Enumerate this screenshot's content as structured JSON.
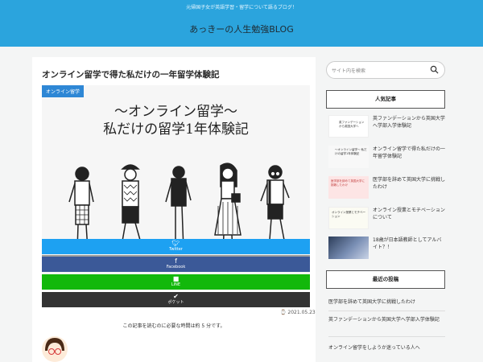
{
  "header": {
    "tagline": "元帰国子女が英語学習・留学について語るブログ！",
    "site_title": "あっきーの人生勉強BLOG"
  },
  "article": {
    "title": "オンライン留学で得た私だけの一年留学体験記",
    "category": "オンライン留学",
    "hero_line1": "〜オンライン留学〜",
    "hero_line2": "私だけの留学1年体験記",
    "date": "2021.05.23",
    "read_time": "この記事を読むのに必要な時間は約 5 分です。"
  },
  "share": {
    "twitter": "Twitter",
    "facebook": "Facebook",
    "line": "LINE",
    "pocket": "ポケット"
  },
  "sidebar": {
    "search_placeholder": "サイト内を検索",
    "popular_heading": "人気記事",
    "popular": [
      {
        "title": "英ファンデーションから英国大学へ学部入学体験記",
        "thumb_text": "英ファンデーションから英国大学へ"
      },
      {
        "title": "オンライン留学で得た私だけの一年留学体験記",
        "thumb_text": "〜オンライン留学〜 私だけの留学1年体験記"
      },
      {
        "title": "医学部を辞めて英国大学に挑戦したわけ",
        "thumb_text": "医学部を辞めて英国大学に挑戦したわけ"
      },
      {
        "title": "オンライン授業とモチベーションについて",
        "thumb_text": "オンライン授業とモチベーション"
      },
      {
        "title": "18歳が日本語教師としてアルバイト？！",
        "thumb_text": ""
      }
    ],
    "recent_heading": "最近の投稿",
    "recent": [
      "医学部を辞めて英国大学に挑戦したわけ",
      "英ファンデーションから英国大学へ学部入学体験記",
      "オンライン留学をしようか迷っている人へ"
    ]
  },
  "colors": {
    "header_bg": "#2ba4dd",
    "twitter": "#1da1f2",
    "facebook": "#3b5998",
    "line": "#12b80b",
    "pocket": "#333333",
    "category_badge": "#2e87d5"
  },
  "icons": {
    "twitter": "twitter-bird-icon",
    "facebook": "facebook-f-icon",
    "line": "line-logo-icon",
    "pocket": "pocket-icon",
    "search": "search-icon"
  }
}
